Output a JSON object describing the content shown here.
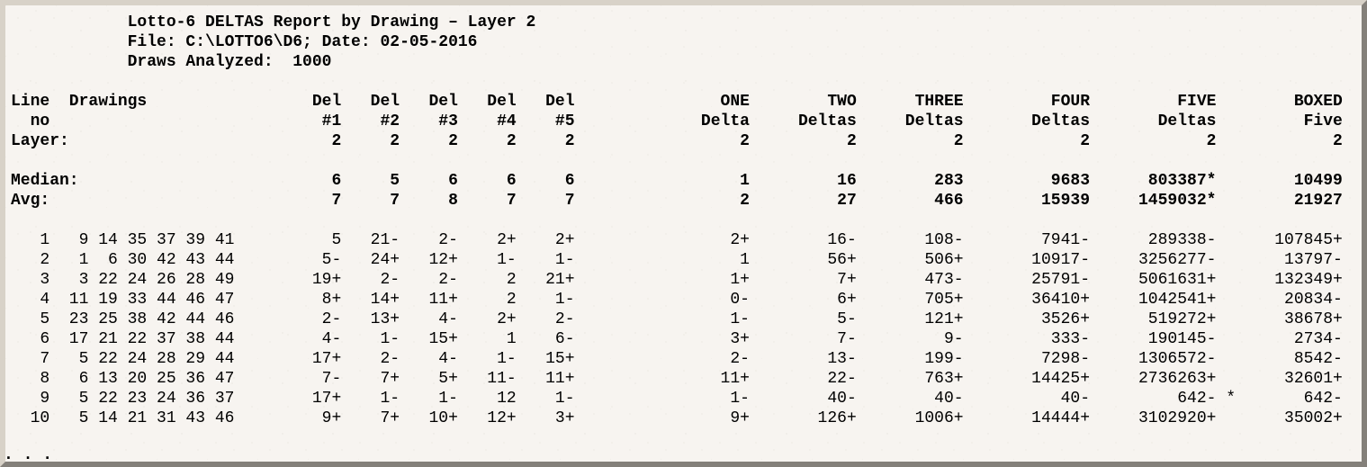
{
  "header": {
    "title": "Lotto-6 DELTAS Report by Drawing – Layer 2",
    "file_line_label": "File:",
    "file_path": "C:\\LOTTO6\\D6",
    "date_label": "Date:",
    "date": "02-05-2016",
    "draws_label": "Draws Analyzed:",
    "draws": "1000"
  },
  "col_headers": {
    "line_no": [
      "Line",
      " no"
    ],
    "drawings": "Drawings",
    "del": [
      "Del",
      "Del",
      "Del",
      "Del",
      "Del"
    ],
    "del_sub": [
      "#1",
      "#2",
      "#3",
      "#4",
      "#5"
    ],
    "one": [
      "ONE",
      "Delta"
    ],
    "two": [
      "TWO",
      "Deltas"
    ],
    "three": [
      "THREE",
      "Deltas"
    ],
    "four": [
      "FOUR",
      "Deltas"
    ],
    "five": [
      "FIVE",
      "Deltas"
    ],
    "boxed": [
      "BOXED",
      "Five"
    ]
  },
  "layer_row": {
    "label": "Layer:",
    "vals": [
      "2",
      "2",
      "2",
      "2",
      "2",
      "2",
      "2",
      "2",
      "2",
      "2",
      "2"
    ]
  },
  "median": {
    "label": "Median:",
    "d": [
      "6",
      "5",
      "6",
      "6",
      "6"
    ],
    "one": "1",
    "two": "16",
    "three": "283",
    "four": "9683",
    "five": "803387*",
    "boxed": "10499"
  },
  "avg": {
    "label": "Avg:",
    "d": [
      "7",
      "7",
      "8",
      "7",
      "7"
    ],
    "one": "2",
    "two": "27",
    "three": "466",
    "four": "15939",
    "five": "1459032*",
    "boxed": "21927"
  },
  "chart_data": {
    "type": "table",
    "columns": [
      "line",
      "drawings",
      "del1",
      "del2",
      "del3",
      "del4",
      "del5",
      "one",
      "two",
      "three",
      "four",
      "five",
      "star",
      "boxed"
    ],
    "rows": [
      {
        "line": 1,
        "drawings": [
          9,
          14,
          35,
          37,
          39,
          41
        ],
        "d": [
          "5",
          "21-",
          "2-",
          "2+",
          "2+"
        ],
        "one": "2+",
        "two": "16-",
        "three": "108-",
        "four": "7941-",
        "five": "289338-",
        "star": "",
        "boxed": "107845+"
      },
      {
        "line": 2,
        "drawings": [
          1,
          6,
          30,
          42,
          43,
          44
        ],
        "d": [
          "5-",
          "24+",
          "12+",
          "1-",
          "1-"
        ],
        "one": "1",
        "two": "56+",
        "three": "506+",
        "four": "10917-",
        "five": "3256277-",
        "star": "",
        "boxed": "13797-"
      },
      {
        "line": 3,
        "drawings": [
          3,
          22,
          24,
          26,
          28,
          49
        ],
        "d": [
          "19+",
          "2-",
          "2-",
          "2",
          "21+"
        ],
        "one": "1+",
        "two": "7+",
        "three": "473-",
        "four": "25791-",
        "five": "5061631+",
        "star": "",
        "boxed": "132349+"
      },
      {
        "line": 4,
        "drawings": [
          11,
          19,
          33,
          44,
          46,
          47
        ],
        "d": [
          "8+",
          "14+",
          "11+",
          "2",
          "1-"
        ],
        "one": "0-",
        "two": "6+",
        "three": "705+",
        "four": "36410+",
        "five": "1042541+",
        "star": "",
        "boxed": "20834-"
      },
      {
        "line": 5,
        "drawings": [
          23,
          25,
          38,
          42,
          44,
          46
        ],
        "d": [
          "2-",
          "13+",
          "4-",
          "2+",
          "2-"
        ],
        "one": "1-",
        "two": "5-",
        "three": "121+",
        "four": "3526+",
        "five": "519272+",
        "star": "",
        "boxed": "38678+"
      },
      {
        "line": 6,
        "drawings": [
          17,
          21,
          22,
          37,
          38,
          44
        ],
        "d": [
          "4-",
          "1-",
          "15+",
          "1",
          "6-"
        ],
        "one": "3+",
        "two": "7-",
        "three": "9-",
        "four": "333-",
        "five": "190145-",
        "star": "",
        "boxed": "2734-"
      },
      {
        "line": 7,
        "drawings": [
          5,
          22,
          24,
          28,
          29,
          44
        ],
        "d": [
          "17+",
          "2-",
          "4-",
          "1-",
          "15+"
        ],
        "one": "2-",
        "two": "13-",
        "three": "199-",
        "four": "7298-",
        "five": "1306572-",
        "star": "",
        "boxed": "8542-"
      },
      {
        "line": 8,
        "drawings": [
          6,
          13,
          20,
          25,
          36,
          47
        ],
        "d": [
          "7-",
          "7+",
          "5+",
          "11-",
          "11+"
        ],
        "one": "11+",
        "two": "22-",
        "three": "763+",
        "four": "14425+",
        "five": "2736263+",
        "star": "",
        "boxed": "32601+"
      },
      {
        "line": 9,
        "drawings": [
          5,
          22,
          23,
          24,
          36,
          37
        ],
        "d": [
          "17+",
          "1-",
          "1-",
          "12",
          "1-"
        ],
        "one": "1-",
        "two": "40-",
        "three": "40-",
        "four": "40-",
        "five": "642-",
        "star": "*",
        "boxed": "642-"
      },
      {
        "line": 10,
        "drawings": [
          5,
          14,
          21,
          31,
          43,
          46
        ],
        "d": [
          "9+",
          "7+",
          "10+",
          "12+",
          "3+"
        ],
        "one": "9+",
        "two": "126+",
        "three": "1006+",
        "four": "14444+",
        "five": "3102920+",
        "star": "",
        "boxed": "35002+"
      }
    ]
  },
  "footer_ellipsis": ". . ."
}
